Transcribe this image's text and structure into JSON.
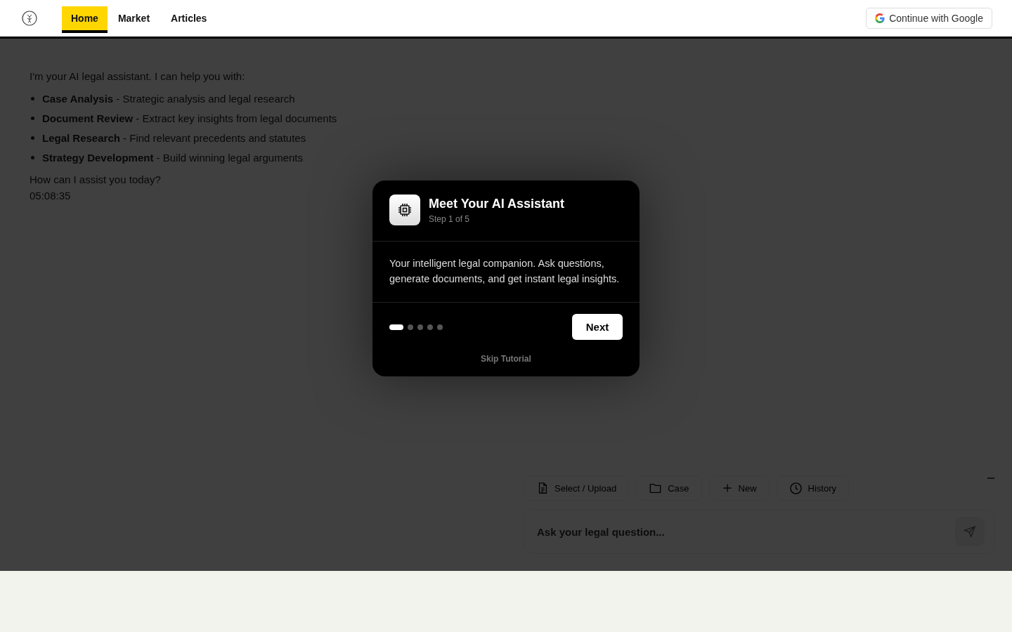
{
  "nav": {
    "tabs": [
      {
        "label": "Home",
        "selected": true
      },
      {
        "label": "Market",
        "selected": false
      },
      {
        "label": "Articles",
        "selected": false
      }
    ],
    "login_button": "Continue with Google"
  },
  "chat": {
    "intro": "I'm your AI legal assistant. I can help you with:",
    "bullets": [
      "**Case Analysis** - Strategic analysis and legal research",
      "**Document Review** - Extract key insights from legal documents",
      "**Legal Research** - Find relevant precedents and statutes",
      "**Strategy Development** - Build winning legal arguments"
    ],
    "question": "How can I assist you today?",
    "time": "05:08:35"
  },
  "composer": {
    "tools": [
      {
        "kind": "document",
        "label": "Select / Upload"
      },
      {
        "kind": "folder",
        "label": "Case"
      },
      {
        "kind": "plus",
        "label": "New"
      },
      {
        "kind": "clock",
        "label": "History"
      }
    ],
    "placeholder": "Ask your legal question..."
  },
  "tutorial": {
    "title": "Meet Your AI Assistant",
    "step": "Step 1 of 5",
    "body": "Your intelligent legal companion. Ask questions, generate documents, and get instant legal insights.",
    "steps": [
      {
        "selected": true
      },
      {
        "selected": false
      },
      {
        "selected": false
      },
      {
        "selected": false
      },
      {
        "selected": false
      }
    ],
    "next_button": "Next",
    "skip_link": "Skip Tutorial"
  }
}
